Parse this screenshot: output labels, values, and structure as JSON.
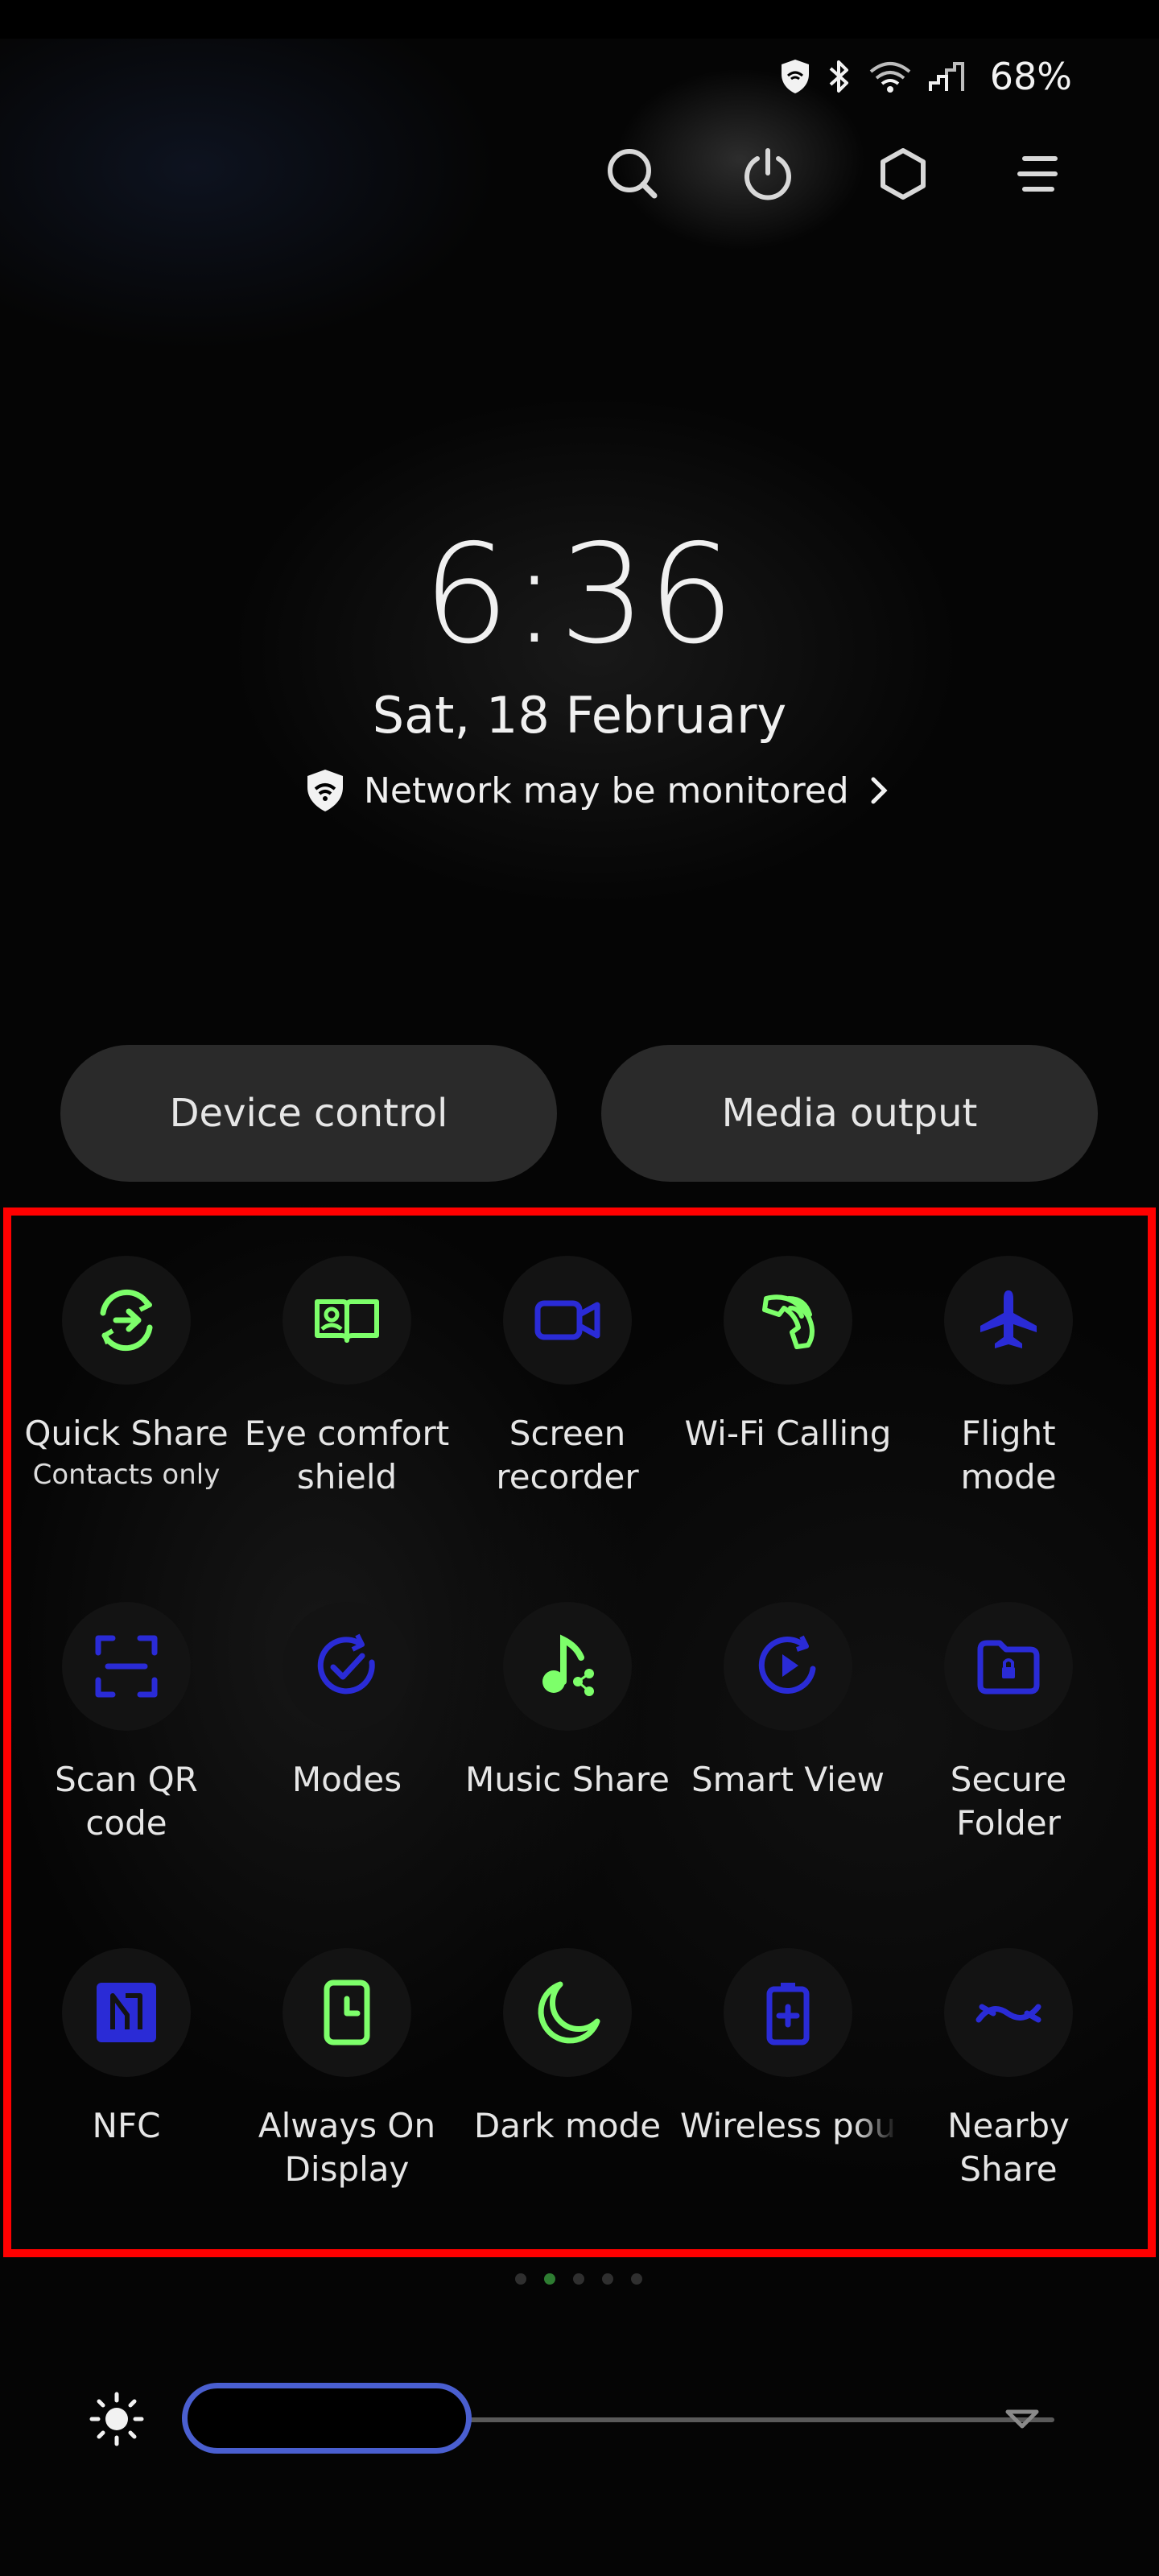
{
  "status_bar": {
    "icons": [
      "vpn-shield-icon",
      "bluetooth-icon",
      "wifi-icon",
      "signal-icon"
    ],
    "battery": "68%"
  },
  "top_actions": [
    "search-icon",
    "power-icon",
    "settings-icon",
    "menu-icon"
  ],
  "clock": {
    "time": "6:36",
    "date": "Sat, 18 February"
  },
  "network_notice": {
    "text": "Network may be monitored"
  },
  "pills": {
    "device_control": "Device control",
    "media_output": "Media output"
  },
  "colors": {
    "green": "#7dff6a",
    "blue": "#2a2bd6",
    "highlight": "#ff0000"
  },
  "tiles": [
    {
      "label": "Quick Share",
      "sub": "Contacts only",
      "icon": "quick-share-icon",
      "state": "on"
    },
    {
      "label": "Eye comfort\nshield",
      "icon": "eye-comfort-icon",
      "state": "on"
    },
    {
      "label": "Screen\nrecorder",
      "icon": "screen-recorder-icon",
      "state": "off"
    },
    {
      "label": "Wi-Fi Calling",
      "icon": "wifi-calling-icon",
      "state": "on"
    },
    {
      "label": "Flight\nmode",
      "icon": "airplane-icon",
      "state": "off"
    },
    {
      "label": "Scan QR\ncode",
      "icon": "qr-scan-icon",
      "state": "off"
    },
    {
      "label": "Modes",
      "icon": "modes-icon",
      "state": "off"
    },
    {
      "label": "Music Share",
      "icon": "music-share-icon",
      "state": "on"
    },
    {
      "label": "Smart View",
      "icon": "smart-view-icon",
      "state": "off"
    },
    {
      "label": "Secure\nFolder",
      "icon": "secure-folder-icon",
      "state": "off"
    },
    {
      "label": "NFC",
      "icon": "nfc-icon",
      "state": "off"
    },
    {
      "label": "Always On\nDisplay",
      "icon": "always-on-display-icon",
      "state": "on"
    },
    {
      "label": "Dark mode",
      "icon": "dark-mode-icon",
      "state": "on"
    },
    {
      "label": "Wireless pou",
      "icon": "wireless-power-icon",
      "state": "off"
    },
    {
      "label": "Nearby\nShare",
      "icon": "nearby-share-icon",
      "state": "off"
    }
  ],
  "page_dots": {
    "count": 5,
    "active_index": 1
  },
  "brightness": {
    "level": 0.2
  }
}
